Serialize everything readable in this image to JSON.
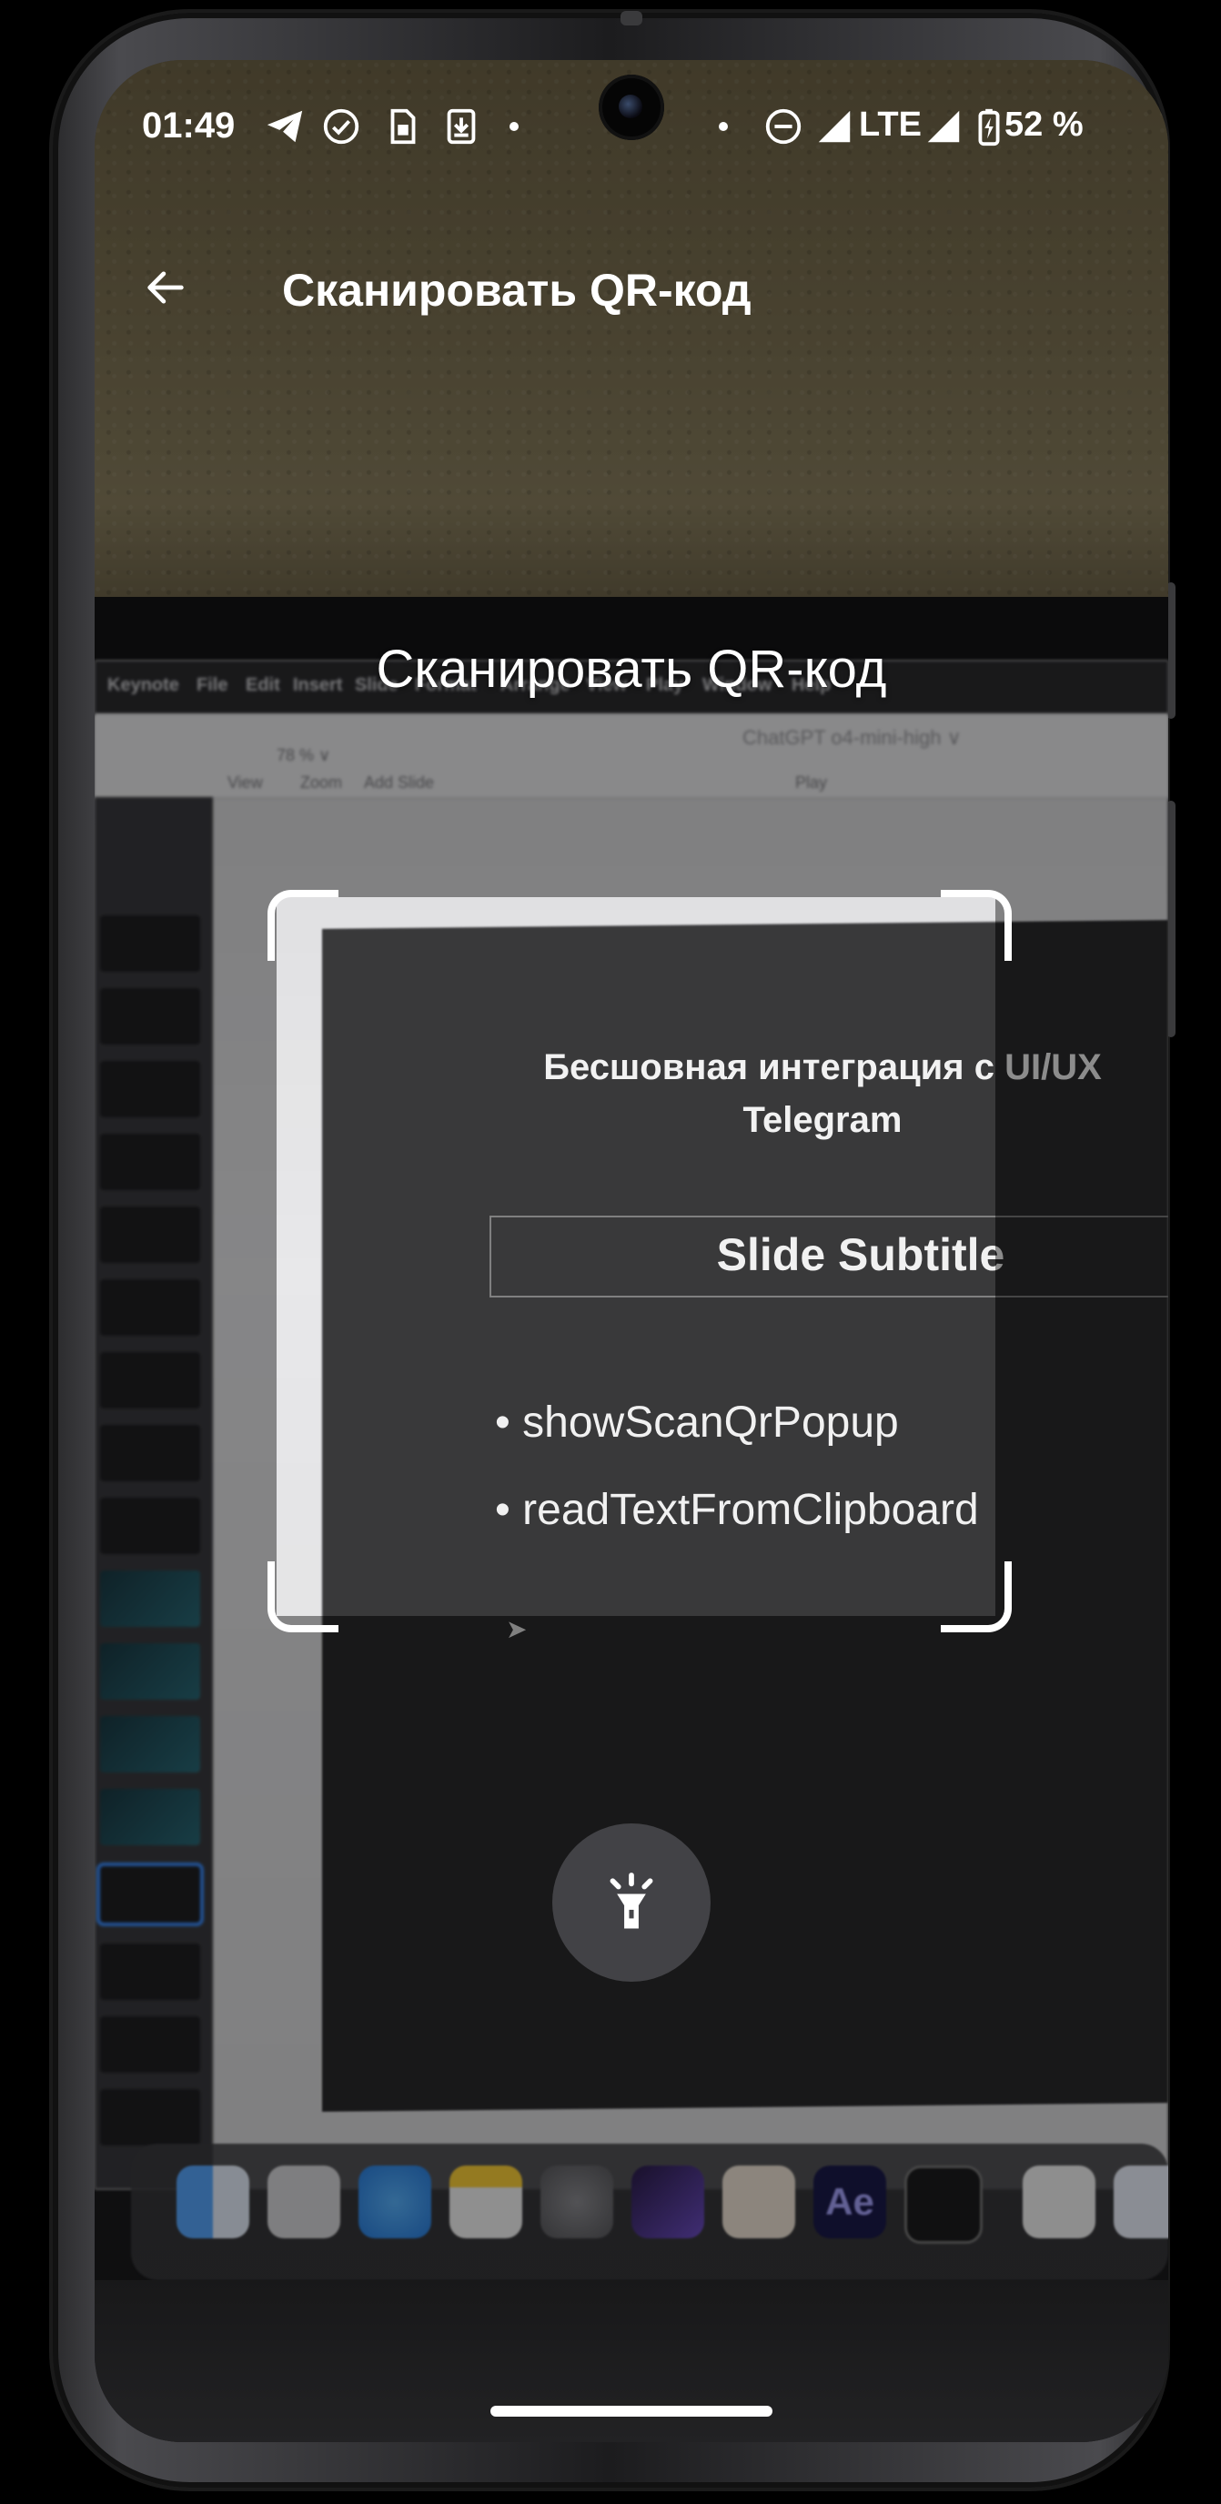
{
  "status_bar": {
    "time": "01:49",
    "network": "LTE",
    "battery": "52 %",
    "icons": [
      "telegram-icon",
      "check-circle-icon",
      "sim-settings-icon",
      "download-icon",
      "dnd-icon",
      "signal-icon",
      "signal-icon-2",
      "battery-charging-icon"
    ]
  },
  "app_bar": {
    "title": "Сканировать QR-код",
    "back_icon": "arrow-back-icon"
  },
  "scanner": {
    "hint": "Сканировать QR-код",
    "flashlight_icon": "flashlight-icon"
  },
  "camera_feed": {
    "menu": [
      "Keynote",
      "File",
      "Edit",
      "Insert",
      "Slide",
      "Format",
      "Arrange",
      "View",
      "Play",
      "Window",
      "Help"
    ],
    "window_title": "ChatGPT o4-mini-high ∨",
    "toolbar": {
      "view": "View",
      "zoom_value": "78 % ∨",
      "zoom": "Zoom",
      "add_slide": "Add Slide",
      "play": "Play"
    },
    "slide": {
      "title_line1": "Бесшовная интеграция с UI/UX",
      "title_line2": "Telegram",
      "subtitle": "Slide Subtitle",
      "bullets": [
        "showScanQrPopup",
        "readTextFromClipboard"
      ]
    },
    "dock_ae": "Ae"
  },
  "colors": {
    "accent_white": "#ffffff",
    "overlay": "#000000",
    "selection_blue": "#3b8dff"
  }
}
